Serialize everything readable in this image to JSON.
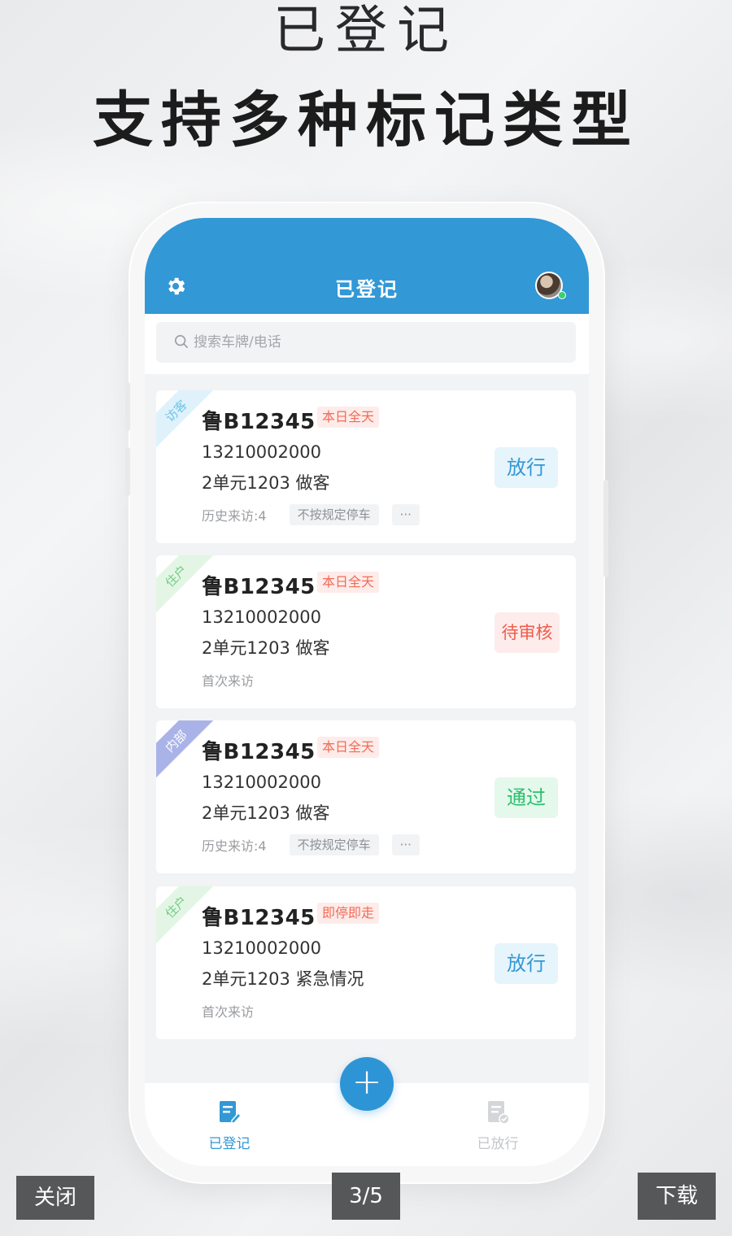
{
  "promo": {
    "subtitle": "已登记",
    "headline": "支持多种标记类型"
  },
  "app": {
    "header_title": "已登记",
    "search_placeholder": "搜索车牌/电话",
    "colors": {
      "primary": "#3298d6",
      "danger": "#f26b56",
      "success": "#2dbf6e"
    },
    "records": [
      {
        "ribbon": "访客",
        "ribbon_color": "#dff2fb",
        "ribbon_text_color": "#6ec3e8",
        "plate": "鲁B12345",
        "time_tag": "本日全天",
        "phone": "13210002000",
        "address": "2单元1203 做客",
        "meta_text": "历史来访:4",
        "chips": [
          "不按规定停车",
          "···"
        ],
        "action": "放行",
        "action_bg": "#e6f4fb",
        "action_color": "#3298d6"
      },
      {
        "ribbon": "住户",
        "ribbon_color": "#e3f6e5",
        "ribbon_text_color": "#73cc82",
        "plate": "鲁B12345",
        "time_tag": "本日全天",
        "phone": "13210002000",
        "address": "2单元1203 做客",
        "meta_text": "首次来访",
        "chips": [],
        "action": "待审核",
        "action_bg": "#fdeceb",
        "action_color": "#ef5b4c"
      },
      {
        "ribbon": "内部",
        "ribbon_color": "#aab3e8",
        "ribbon_text_color": "#ffffff",
        "plate": "鲁B12345",
        "time_tag": "本日全天",
        "phone": "13210002000",
        "address": "2单元1203 做客",
        "meta_text": "历史来访:4",
        "chips": [
          "不按规定停车",
          "···"
        ],
        "action": "通过",
        "action_bg": "#e4f8ec",
        "action_color": "#2dbf6e"
      },
      {
        "ribbon": "住户",
        "ribbon_color": "#e3f6e5",
        "ribbon_text_color": "#73cc82",
        "plate": "鲁B12345",
        "time_tag": "即停即走",
        "phone": "13210002000",
        "address": "2单元1203 紧急情况",
        "meta_text": "首次来访",
        "chips": [],
        "action": "放行",
        "action_bg": "#e6f4fb",
        "action_color": "#3298d6"
      }
    ],
    "tabs": [
      {
        "label": "已登记",
        "active": true,
        "icon": "registered-doc-icon"
      },
      {
        "label": "已放行",
        "active": false,
        "icon": "released-doc-icon"
      }
    ],
    "fab_symbol": "+"
  },
  "viewer": {
    "close_label": "关闭",
    "page_indicator": "3/5",
    "download_label": "下载"
  }
}
